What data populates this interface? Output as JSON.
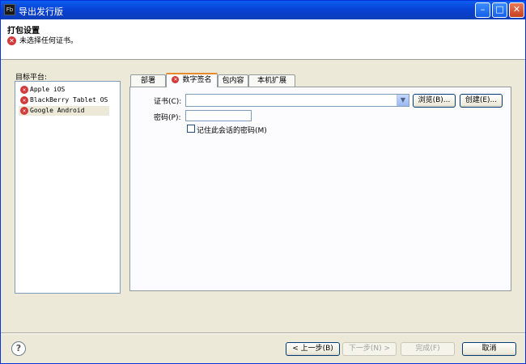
{
  "window": {
    "app_icon_text": "Fb",
    "title": "导出发行版",
    "minimize_glyph": "–",
    "maximize_glyph": "□",
    "close_glyph": "✕"
  },
  "header": {
    "title": "打包设置",
    "error_message": "未选择任何证书。",
    "error_icon_glyph": "✕"
  },
  "platforms": {
    "label": "目标平台:",
    "items": [
      {
        "label": "Apple iOS",
        "status": "error"
      },
      {
        "label": "BlackBerry Tablet OS",
        "status": "error"
      },
      {
        "label": "Google Android",
        "status": "error",
        "selected": true
      }
    ]
  },
  "tabs": [
    {
      "label": "部署"
    },
    {
      "label": "数字签名",
      "active": true,
      "status": "error"
    },
    {
      "label": "包内容"
    },
    {
      "label": "本机扩展"
    }
  ],
  "signature": {
    "cert_label": "证书(C):",
    "cert_value": "",
    "browse_label": "浏览(B)...",
    "create_label": "创建(E)...",
    "password_label": "密码(P):",
    "password_value": "",
    "remember_label": "记住此会话的密码(M)",
    "remember_checked": false,
    "combo_arrow": "▼"
  },
  "footer": {
    "help_glyph": "?",
    "back_label": "< 上一步(B)",
    "next_label": "下一步(N) >",
    "finish_label": "完成(F)",
    "cancel_label": "取消"
  },
  "colors": {
    "title_bar": "#0a5ef0",
    "error": "#d23a3a",
    "tab_active_accent": "#e68b2c",
    "dialog_bg": "#ece9d8"
  }
}
